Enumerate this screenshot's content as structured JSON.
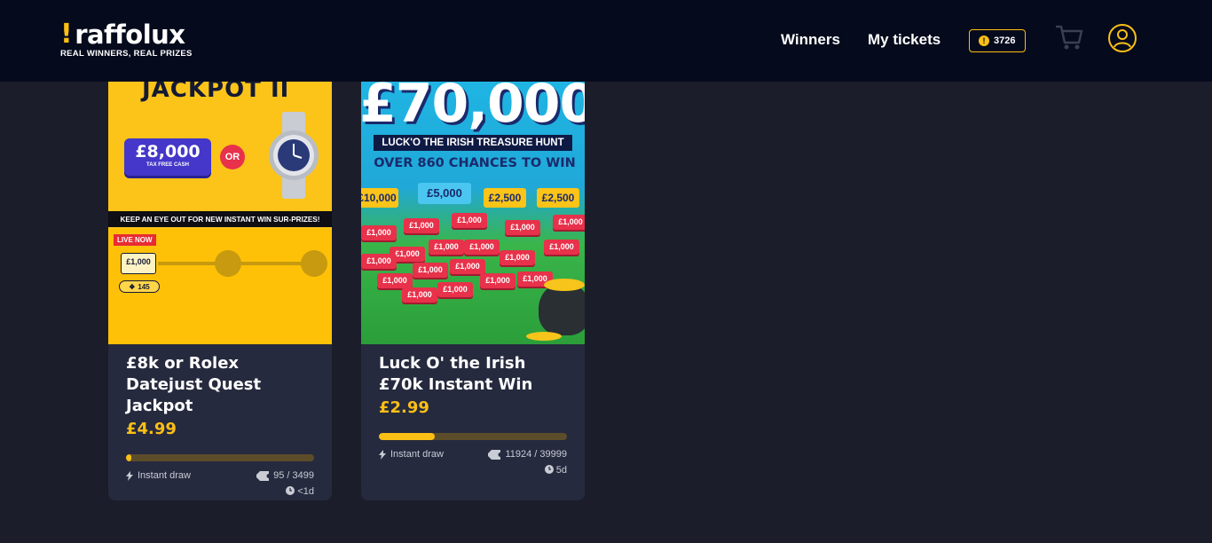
{
  "header": {
    "logo": {
      "name": "raffolux",
      "tagline": "REAL WINNERS, REAL PRIZES"
    },
    "nav": {
      "winners": "Winners",
      "my_tickets": "My tickets"
    },
    "coins": {
      "symbol": "!",
      "count": "3726"
    }
  },
  "cards": [
    {
      "title": "£8k or Rolex Datejust Quest Jackpot",
      "price": "£4.99",
      "progress": 0.027,
      "draw_type": "Instant draw",
      "tickets": "95 / 3499",
      "time_left": "<1d",
      "art": {
        "heading": "JACKPOT II",
        "prize": "£8,000",
        "prize_sub": "TAX FREE CASH",
        "or": "OR",
        "banner": "KEEP AN EYE OUT FOR NEW INSTANT WIN SUR-PRIZES!",
        "live_badge": "LIVE NOW",
        "mini_prize": "£1,000",
        "ticket_count": "145"
      }
    },
    {
      "title": "Luck O' the Irish £70k Instant Win",
      "price": "£2.99",
      "progress": 0.298,
      "draw_type": "Instant draw",
      "tickets": "11924 / 39999",
      "time_left": "5d",
      "art": {
        "heading": "£70,000",
        "sub1": "LUCK'O THE IRISH TREASURE HUNT",
        "sub2": "OVER 860 CHANCES TO WIN",
        "prize_blue": "£5,000",
        "prize_yellow": "£2,500",
        "prize_jackpot": "£10,000",
        "prize_red": "£1,000"
      }
    }
  ],
  "colors": {
    "accent": "#fbbf16",
    "header_bg": "#050a1c",
    "page_bg": "#1b1d2a",
    "card_bg": "#262a3e"
  }
}
